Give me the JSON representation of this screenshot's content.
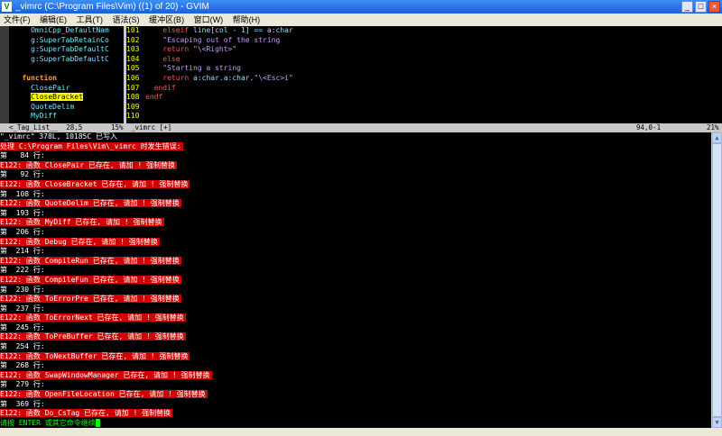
{
  "window": {
    "title": "_vimrc (C:\\Program Files\\Vim) ((1) of 20) - GVIM",
    "icon_glyph": "V",
    "controls": [
      "_",
      "□",
      "×"
    ]
  },
  "menu": [
    "文件(F)",
    "编辑(E)",
    "工具(T)",
    "语法(S)",
    "缓冲区(B)",
    "窗口(W)",
    "帮助(H)"
  ],
  "taglist": {
    "lines": [
      {
        "text": "OmniCpp_DefaultNam",
        "indent": 5,
        "color": "cyan"
      },
      {
        "text": "g:SuperTabRetainCo",
        "indent": 5,
        "color": "cyan"
      },
      {
        "text": "g:SuperTabDefaultC",
        "indent": 5,
        "color": "cyan"
      },
      {
        "text": "g:SuperTabDefaultC",
        "indent": 5,
        "color": "cyan"
      },
      {
        "text": "",
        "indent": 0,
        "color": "cyan"
      },
      {
        "text": "function",
        "indent": 3,
        "color": "orn"
      },
      {
        "text": "ClosePair",
        "indent": 5,
        "color": "cyan"
      },
      {
        "text": "CloseBracket",
        "indent": 5,
        "color": "sel"
      },
      {
        "text": "QuoteDelim",
        "indent": 5,
        "color": "cyan"
      },
      {
        "text": "MyDiff",
        "indent": 5,
        "color": "cyan"
      }
    ]
  },
  "code": {
    "lines": [
      {
        "num": "101",
        "html": "    <span class='kw'>elseif</span> <span class='fn'>line[col - 1] == a:char</span>"
      },
      {
        "num": "102",
        "html": "    <span class='str'>\"Escaping out of the string</span>"
      },
      {
        "num": "103",
        "html": "    <span class='kw'>return</span> <span class='str'>\"\\&lt;Right&gt;\"</span>"
      },
      {
        "num": "104",
        "html": "    <span class='kw'>else</span>"
      },
      {
        "num": "105",
        "html": "    <span class='str'>\"Starting a string</span>"
      },
      {
        "num": "106",
        "html": "    <span class='kw'>return</span> <span class='fn'>a:char.a:char.</span><span class='str'>\"\\&lt;Esc&gt;i\"</span>"
      },
      {
        "num": "107",
        "html": "  <span class='kw'>endif</span>"
      },
      {
        "num": "108",
        "html": "<span class='kw'>endf</span>"
      },
      {
        "num": "109",
        "html": ""
      },
      {
        "num": "110",
        "html": ""
      }
    ]
  },
  "statusbar": {
    "left": "<_Tag_List__  28,5",
    "left_pct": "15%",
    "filename": "_vimrc [+]",
    "position": "94,0-1",
    "right_pct": "21%"
  },
  "messages": {
    "written": "\"_vimrc\" 378L, 10185C 已写入",
    "header": "处理 C:\\Program Files\\Vim\\_vimrc 时发生错误:",
    "entries": [
      {
        "line": "第   84 行:",
        "error": "E122: 函数 ClosePair 已存在, 请加 ! 强制替换"
      },
      {
        "line": "第   92 行:",
        "error": "E122: 函数 CloseBracket 已存在, 请加 ! 强制替换"
      },
      {
        "line": "第  108 行:",
        "error": "E122: 函数 QuoteDelim 已存在, 请加 ! 强制替换"
      },
      {
        "line": "第  193 行:",
        "error": "E122: 函数 MyDiff 已存在, 请加 ! 强制替换"
      },
      {
        "line": "第  206 行:",
        "error": "E122: 函数 Debug 已存在, 请加 ! 强制替换"
      },
      {
        "line": "第  214 行:",
        "error": "E122: 函数 CompileRun 已存在, 请加 ! 强制替换"
      },
      {
        "line": "第  222 行:",
        "error": "E122: 函数 CompileFun 已存在, 请加 ! 强制替换"
      },
      {
        "line": "第  230 行:",
        "error": "E122: 函数 ToErrorPre 已存在, 请加 ! 强制替换"
      },
      {
        "line": "第  237 行:",
        "error": "E122: 函数 ToErrorNext 已存在, 请加 ! 强制替换"
      },
      {
        "line": "第  245 行:",
        "error": "E122: 函数 ToPreBuffer 已存在, 请加 ! 强制替换"
      },
      {
        "line": "第  254 行:",
        "error": "E122: 函数 ToNextBuffer 已存在, 请加 ! 强制替换"
      },
      {
        "line": "第  268 行:",
        "error": "E122: 函数 SwapWindowManager 已存在, 请加 ! 强制替换"
      },
      {
        "line": "第  279 行:",
        "error": "E122: 函数 OpenFileLocation 已存在, 请加 ! 强制替换"
      },
      {
        "line": "第  369 行:",
        "error": "E122: 函数 Do_CsTag 已存在, 请加 ! 强制替换"
      }
    ],
    "prompt": "请按 ENTER 或其它命令继续"
  },
  "scrollbar": {
    "up_glyph": "▲",
    "down_glyph": "▼"
  },
  "colors": {
    "error_bg": "#d00000",
    "prompt": "#00ff00",
    "title_bar": "#1c5fd6",
    "selected_tag": "#ffff00"
  }
}
